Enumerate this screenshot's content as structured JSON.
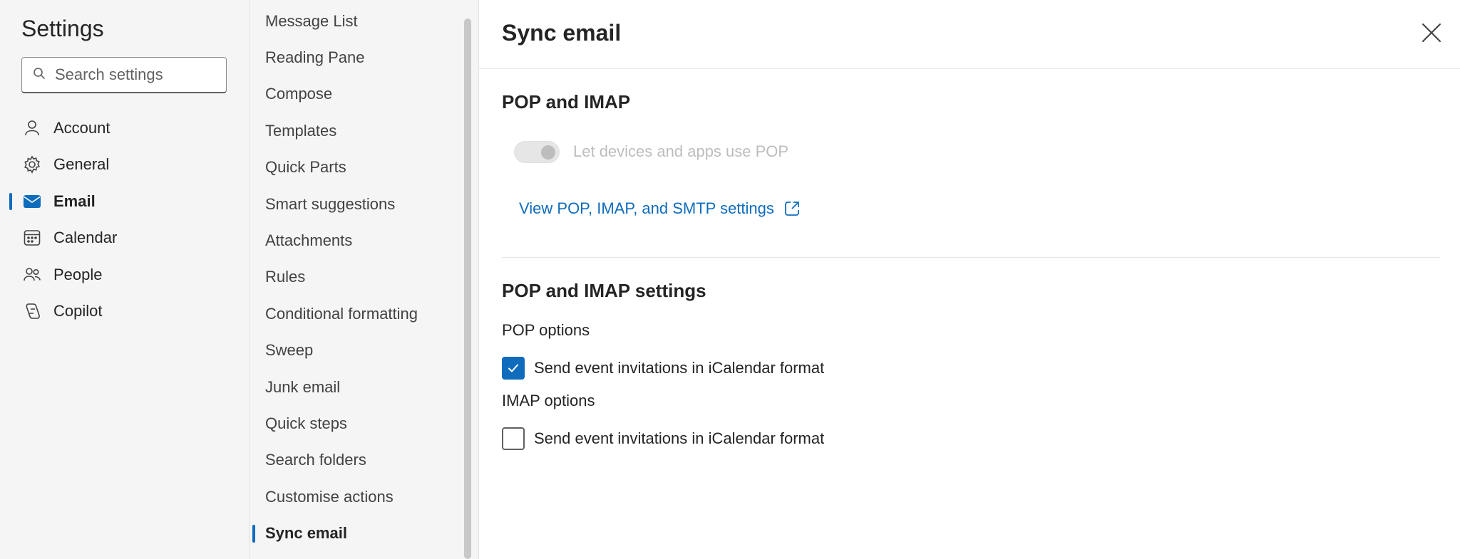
{
  "sidebar": {
    "title": "Settings",
    "search_placeholder": "Search settings",
    "items": [
      {
        "label": "Account",
        "icon": "person-icon"
      },
      {
        "label": "General",
        "icon": "gear-icon"
      },
      {
        "label": "Email",
        "icon": "mail-icon",
        "active": true
      },
      {
        "label": "Calendar",
        "icon": "calendar-icon"
      },
      {
        "label": "People",
        "icon": "people-icon"
      },
      {
        "label": "Copilot",
        "icon": "copilot-icon"
      }
    ]
  },
  "subnav": {
    "items": [
      "Message List",
      "Reading Pane",
      "Compose",
      "Templates",
      "Quick Parts",
      "Smart suggestions",
      "Attachments",
      "Rules",
      "Conditional formatting",
      "Sweep",
      "Junk email",
      "Quick steps",
      "Search folders",
      "Customise actions",
      "Sync email"
    ],
    "active": "Sync email"
  },
  "content": {
    "title": "Sync email",
    "section1": {
      "title": "POP and IMAP",
      "toggle_label": "Let devices and apps use POP",
      "toggle_on": true,
      "toggle_disabled": true,
      "link_label": "View POP, IMAP, and SMTP settings"
    },
    "section2": {
      "title": "POP and IMAP settings",
      "pop_label": "POP options",
      "pop_checkbox_label": "Send event invitations in iCalendar format",
      "pop_checked": true,
      "imap_label": "IMAP options",
      "imap_checkbox_label": "Send event invitations in iCalendar format",
      "imap_checked": false
    }
  },
  "colors": {
    "accent": "#0f6cbd",
    "nav_bg": "#f5f5f5",
    "disabled_text": "#bdbdbd"
  }
}
